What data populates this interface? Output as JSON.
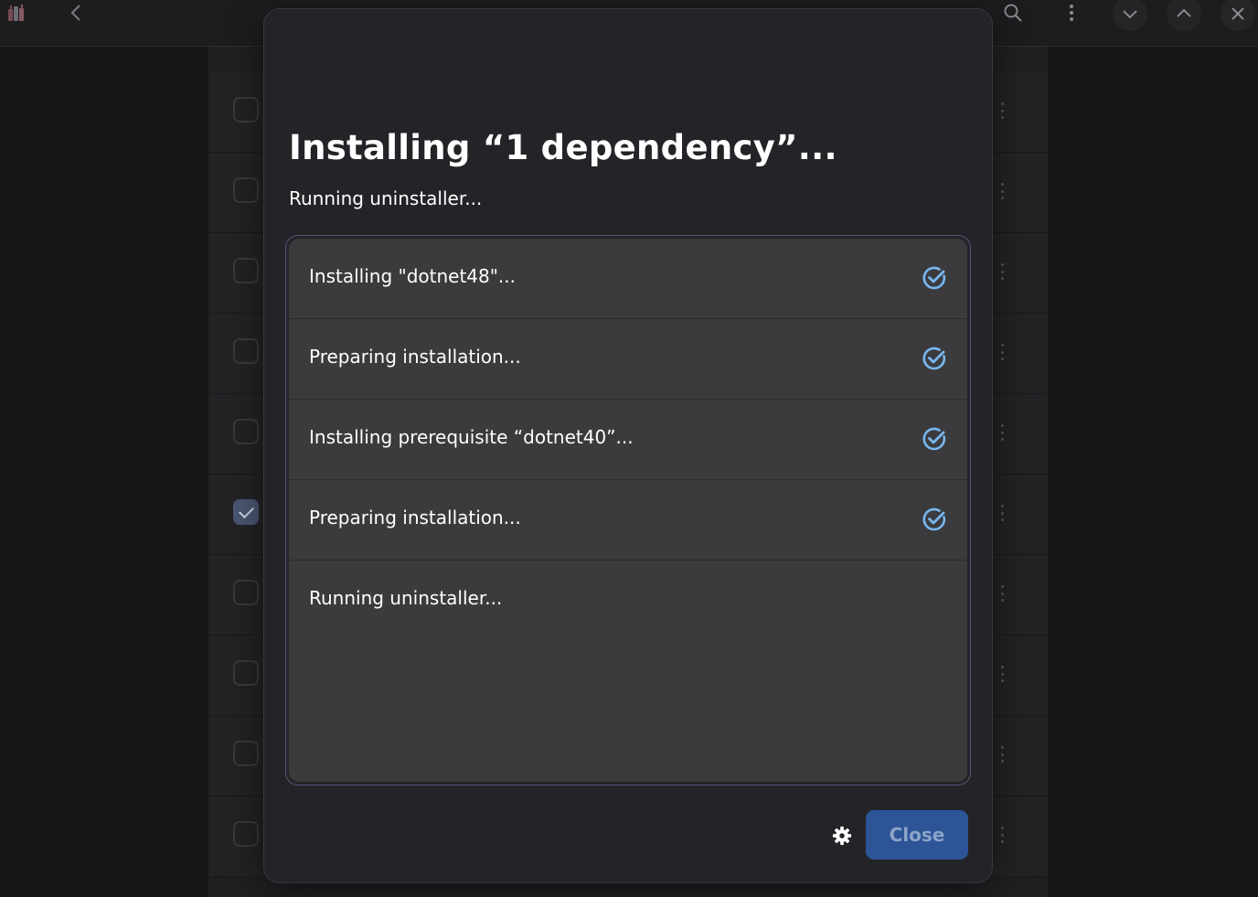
{
  "colors": {
    "accent_check": "#78b7f0",
    "close_button_bg": "#2d5497",
    "dialog_bg": "#242428",
    "list_bg": "#3b3b3e"
  },
  "header": {
    "app_icon": "wine-bottles-icon",
    "back_icon": "chevron-left-icon",
    "search_icon": "search-icon",
    "menu_icon": "vertical-dots-icon",
    "minimize_icon": "chevron-down-icon",
    "maximize_icon": "chevron-up-icon",
    "close_icon": "close-icon"
  },
  "background_list": {
    "rows": [
      {
        "checked": false
      },
      {
        "checked": false
      },
      {
        "checked": false
      },
      {
        "checked": false
      },
      {
        "checked": false
      },
      {
        "checked": true
      },
      {
        "checked": false
      },
      {
        "checked": false
      },
      {
        "checked": false
      },
      {
        "checked": false
      }
    ]
  },
  "dialog": {
    "title": "Installing “1 dependency”...",
    "subtitle": "Running uninstaller...",
    "steps": [
      {
        "label": "Installing \"dotnet48\"...",
        "done": true,
        "icon": "check-circle-icon"
      },
      {
        "label": "Preparing installation...",
        "done": true,
        "icon": "check-circle-icon"
      },
      {
        "label": "Installing prerequisite “dotnet40”...",
        "done": true,
        "icon": "check-circle-icon"
      },
      {
        "label": "Preparing installation...",
        "done": true,
        "icon": "check-circle-icon"
      },
      {
        "label": "Running uninstaller...",
        "done": false
      }
    ],
    "settings_icon": "gear-icon",
    "close_label": "Close"
  }
}
